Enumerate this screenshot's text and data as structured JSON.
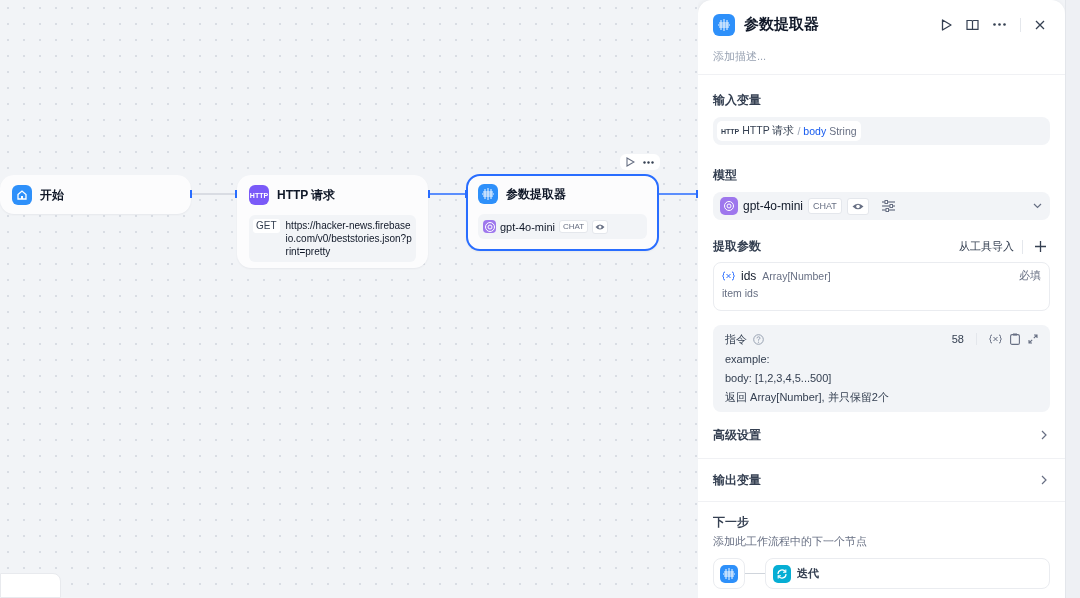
{
  "canvas": {
    "nodes": [
      {
        "kind": "start",
        "title": "开始",
        "selected": false
      },
      {
        "kind": "http",
        "title": "HTTP 请求",
        "icon_text": "HTTP",
        "method": "GET",
        "url": "https://hacker-news.firebaseio.com/v0/beststories.json?print=pretty",
        "selected": false
      },
      {
        "kind": "extractor",
        "title": "参数提取器",
        "model": "gpt-4o-mini",
        "model_tag": "CHAT",
        "selected": true
      }
    ]
  },
  "panel": {
    "title": "参数提取器",
    "description": {
      "placeholder": "添加描述..."
    },
    "input_section": {
      "label": "输入变量",
      "variable": {
        "icon_text": "HTTP",
        "node": "HTTP 请求",
        "separator": "/",
        "name": "body",
        "type": "String"
      }
    },
    "model_section": {
      "label": "模型",
      "model": "gpt-4o-mini",
      "tag": "CHAT"
    },
    "params_section": {
      "label": "提取参数",
      "import_link": "从工具导入",
      "params": [
        {
          "name": "ids",
          "type": "Array[Number]",
          "required": "必填",
          "description": "item ids"
        }
      ]
    },
    "instruction": {
      "label": "指令",
      "count": "58",
      "lines": [
        "example:",
        "body: [1,2,3,4,5...500]",
        "返回 Array[Number], 并只保留2个"
      ]
    },
    "collapsed_sections": [
      {
        "label": "高级设置",
        "expanded": false
      },
      {
        "label": "输出变量",
        "expanded": false
      }
    ],
    "next_step": {
      "label": "下一步",
      "subtitle": "添加此工作流程中的下一个节点",
      "next_node": "迭代"
    }
  }
}
